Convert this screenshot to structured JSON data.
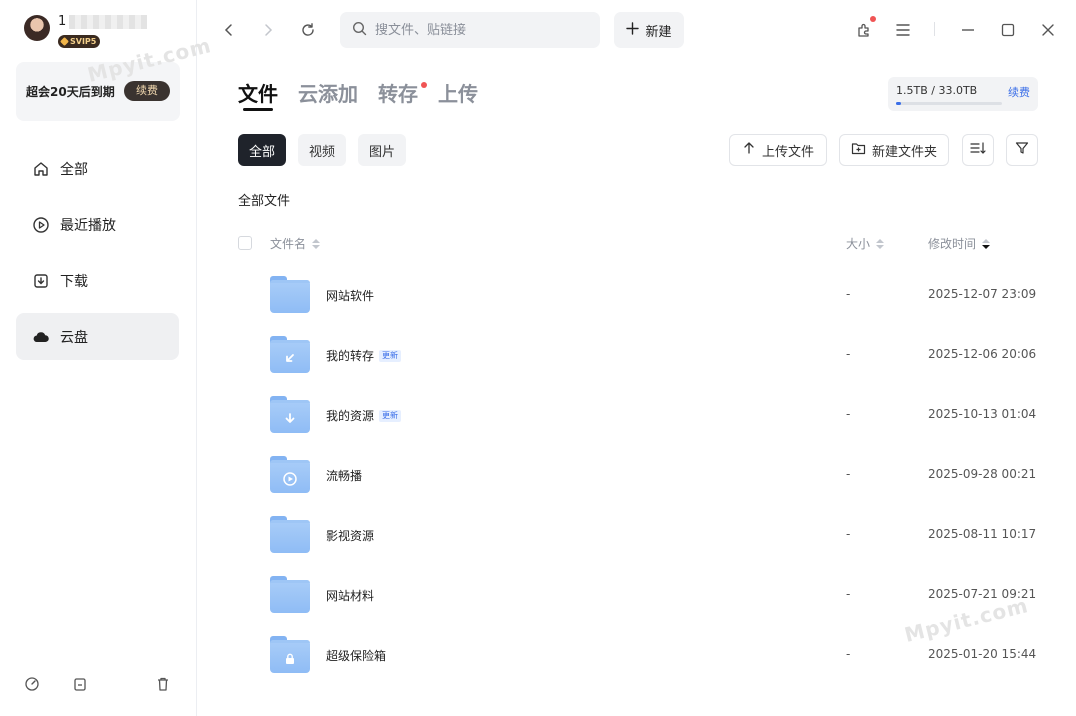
{
  "user": {
    "name_prefix": "1",
    "vip_label": "SVIP5"
  },
  "membership": {
    "expire_text": "超会20天后到期",
    "renew_label": "续费"
  },
  "sidebar": {
    "items": [
      {
        "label": "全部",
        "icon": "home-icon"
      },
      {
        "label": "最近播放",
        "icon": "play-circle-icon"
      },
      {
        "label": "下载",
        "icon": "download-icon"
      },
      {
        "label": "云盘",
        "icon": "cloud-icon",
        "active": true
      }
    ],
    "bottom_icons": [
      "speed-icon",
      "archive-icon",
      "trash-icon"
    ]
  },
  "toolbar": {
    "search_placeholder": "搜文件、贴链接",
    "new_label": "新建"
  },
  "tabs": [
    {
      "label": "文件",
      "active": true
    },
    {
      "label": "云添加"
    },
    {
      "label": "转存",
      "dot": true
    },
    {
      "label": "上传"
    }
  ],
  "quota": {
    "text": "1.5TB / 33.0TB",
    "renew_label": "续费",
    "used_fraction": 0.045,
    "accent": "#3a6ee8"
  },
  "filters": [
    {
      "label": "全部",
      "active": true
    },
    {
      "label": "视频"
    },
    {
      "label": "图片"
    }
  ],
  "actions": {
    "upload_label": "上传文件",
    "new_folder_label": "新建文件夹"
  },
  "breadcrumb": "全部文件",
  "table": {
    "headers": {
      "name": "文件名",
      "size": "大小",
      "modified": "修改时间"
    },
    "rows": [
      {
        "name": "网站软件",
        "size": "-",
        "modified": "2025-12-07 23:09",
        "glyph": "",
        "badge": ""
      },
      {
        "name": "我的转存",
        "size": "-",
        "modified": "2025-12-06 20:06",
        "glyph": "transfer",
        "badge": "更新"
      },
      {
        "name": "我的资源",
        "size": "-",
        "modified": "2025-10-13 01:04",
        "glyph": "download",
        "badge": "更新"
      },
      {
        "name": "流畅播",
        "size": "-",
        "modified": "2025-09-28 00:21",
        "glyph": "play",
        "badge": ""
      },
      {
        "name": "影视资源",
        "size": "-",
        "modified": "2025-08-11 10:17",
        "glyph": "",
        "badge": ""
      },
      {
        "name": "网站材料",
        "size": "-",
        "modified": "2025-07-21 09:21",
        "glyph": "",
        "badge": ""
      },
      {
        "name": "超级保险箱",
        "size": "-",
        "modified": "2025-01-20 15:44",
        "glyph": "lock",
        "badge": ""
      }
    ]
  },
  "watermark": "Mpyit.com"
}
